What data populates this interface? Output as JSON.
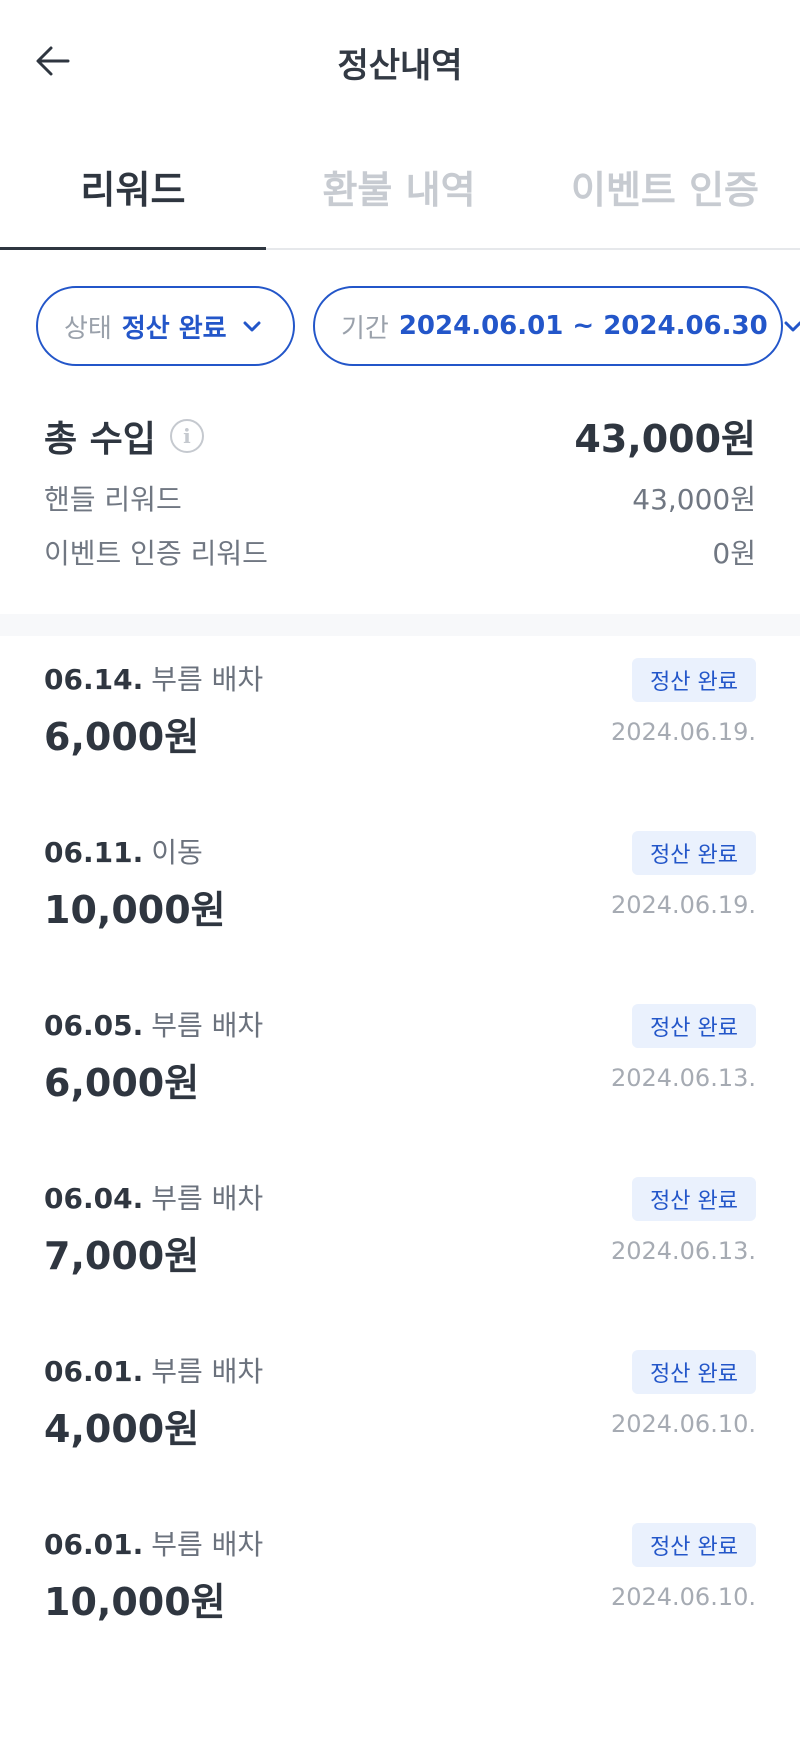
{
  "header": {
    "title": "정산내역"
  },
  "tabs": [
    {
      "label": "리워드",
      "active": true
    },
    {
      "label": "환불 내역",
      "active": false
    },
    {
      "label": "이벤트 인증",
      "active": false
    }
  ],
  "filters": {
    "status": {
      "label": "상태",
      "value": "정산 완료"
    },
    "period": {
      "label": "기간",
      "value": "2024.06.01 ~ 2024.06.30"
    }
  },
  "summary": {
    "total_label": "총 수입",
    "total_value": "43,000원",
    "rows": [
      {
        "label": "핸들 리워드",
        "value": "43,000원"
      },
      {
        "label": "이벤트 인증 리워드",
        "value": "0원"
      }
    ]
  },
  "items": [
    {
      "date": "06.14.",
      "desc": "부름 배차",
      "amount": "6,000원",
      "status": "정산 완료",
      "settled_date": "2024.06.19."
    },
    {
      "date": "06.11.",
      "desc": "이동",
      "amount": "10,000원",
      "status": "정산 완료",
      "settled_date": "2024.06.19."
    },
    {
      "date": "06.05.",
      "desc": "부름 배차",
      "amount": "6,000원",
      "status": "정산 완료",
      "settled_date": "2024.06.13."
    },
    {
      "date": "06.04.",
      "desc": "부름 배차",
      "amount": "7,000원",
      "status": "정산 완료",
      "settled_date": "2024.06.13."
    },
    {
      "date": "06.01.",
      "desc": "부름 배차",
      "amount": "4,000원",
      "status": "정산 완료",
      "settled_date": "2024.06.10."
    },
    {
      "date": "06.01.",
      "desc": "부름 배차",
      "amount": "10,000원",
      "status": "정산 완료",
      "settled_date": "2024.06.10."
    }
  ],
  "colors": {
    "accent": "#2356c9",
    "badge_bg": "#eaf1fd",
    "text": "#2f3640",
    "muted": "#707782",
    "tab_inactive": "#c7cbd1"
  },
  "icons": {
    "back": "arrow-left-icon",
    "chevron": "chevron-down-icon",
    "info": "info-icon"
  }
}
